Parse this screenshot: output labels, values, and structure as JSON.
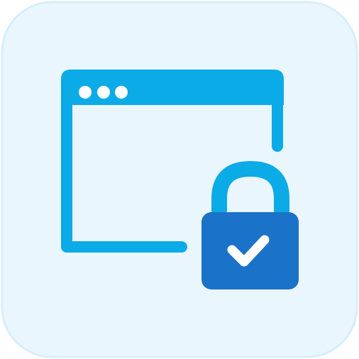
{
  "icon": {
    "name": "secure-browser-window-icon",
    "parts": [
      "browser-window-icon",
      "padlock-icon",
      "checkmark-icon"
    ]
  },
  "colors": {
    "tile_fill": "#eaf6fe",
    "tile_border": "#d6eefc",
    "window_stroke": "#0aabe6",
    "window_dots": "#ffffff",
    "shackle": "#0aabe6",
    "lock_body": "#1a73c8",
    "checkmark": "#ffffff"
  }
}
